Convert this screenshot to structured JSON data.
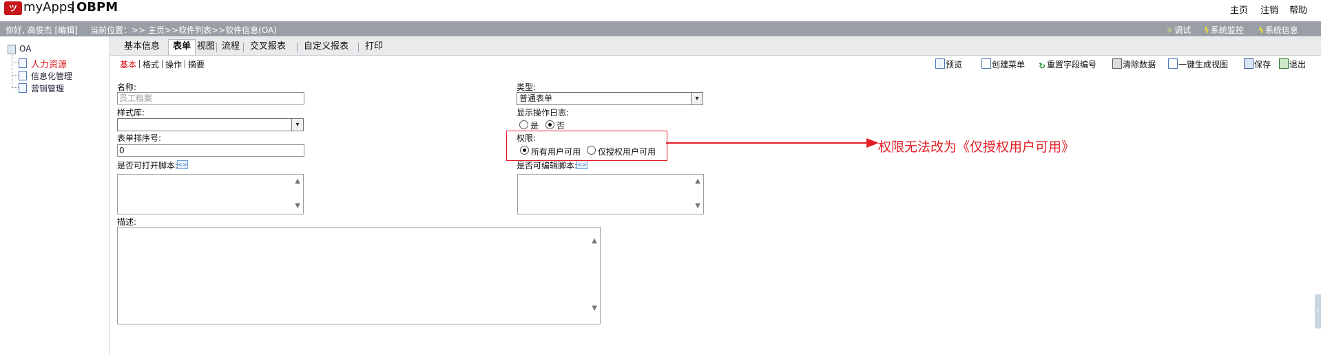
{
  "header": {
    "logo_badge": "ツ",
    "app_name": "myApps",
    "product": "OBPM",
    "links": [
      "主页",
      "注销",
      "帮助"
    ]
  },
  "infobar": {
    "greeting": "你好, 高俊杰 [编辑]",
    "location": "当前位置：>> 主页>>软件列表>>软件信息(OA)",
    "tools": [
      "调试",
      "系统监控",
      "系统信息"
    ]
  },
  "tree": {
    "root": "OA",
    "items": [
      "人力资源",
      "信息化管理",
      "营销管理"
    ]
  },
  "tabs": [
    "基本信息",
    "表单",
    "视图",
    "流程",
    "交叉报表",
    "自定义报表",
    "打印"
  ],
  "subtabs": [
    "基本",
    "格式",
    "操作",
    "摘要"
  ],
  "toolbar": [
    "预览",
    "创建菜单",
    "重置字段编号",
    "清除数据",
    "一键生成视图",
    "保存",
    "退出"
  ],
  "form": {
    "name_label": "名称:",
    "name_placeholder": "员工档案",
    "type_label": "类型:",
    "type_value": "普通表单",
    "style_label": "样式库:",
    "style_value": "",
    "log_label": "显示操作日志:",
    "log_yes": "是",
    "log_no": "否",
    "order_label": "表单排序号:",
    "order_value": "0",
    "perm_label": "权限:",
    "perm_all": "所有用户可用",
    "perm_granted": "仅授权用户可用",
    "open_script_label": "是否可打开脚本:",
    "edit_script_label": "是否可编辑脚本:",
    "desc_label": "描述:"
  },
  "annotation": {
    "text": "权限无法改为《仅授权用户可用》",
    "color": "#e21f26"
  },
  "colors": {
    "active_red": "#d8131b",
    "infobar": "#9a9fa6"
  }
}
